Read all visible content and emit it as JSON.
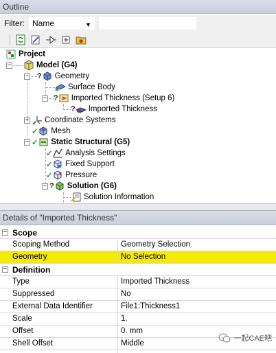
{
  "outline": {
    "title": "Outline",
    "filter_label": "Filter:",
    "filter_value": "Name",
    "filter_search": ""
  },
  "tree": [
    {
      "label": "Project",
      "bold": true,
      "icon": "project-icon"
    },
    {
      "label": "Model (G4)",
      "bold": true,
      "icon": "model-icon"
    },
    {
      "label": "Geometry",
      "bold": false,
      "icon": "geometry-icon"
    },
    {
      "label": "Surface Body",
      "bold": false,
      "icon": "surface-body-icon"
    },
    {
      "label": "Imported Thickness (Setup 6)",
      "bold": false,
      "icon": "imported-thickness-folder-icon"
    },
    {
      "label": "Imported Thickness",
      "bold": false,
      "icon": "imported-thickness-icon"
    },
    {
      "label": "Coordinate Systems",
      "bold": false,
      "icon": "coordinate-systems-icon"
    },
    {
      "label": "Mesh",
      "bold": false,
      "icon": "mesh-icon"
    },
    {
      "label": "Static Structural (G5)",
      "bold": true,
      "icon": "static-structural-icon"
    },
    {
      "label": "Analysis Settings",
      "bold": false,
      "icon": "analysis-settings-icon"
    },
    {
      "label": "Fixed Support",
      "bold": false,
      "icon": "fixed-support-icon"
    },
    {
      "label": "Pressure",
      "bold": false,
      "icon": "pressure-icon"
    },
    {
      "label": "Solution (G6)",
      "bold": true,
      "icon": "solution-icon"
    },
    {
      "label": "Solution Information",
      "bold": false,
      "icon": "solution-information-icon"
    }
  ],
  "details": {
    "title": "Details of \"Imported Thickness\"",
    "sections": [
      {
        "name": "Scope",
        "rows": [
          {
            "key": "Scoping Method",
            "value": "Geometry Selection"
          },
          {
            "key": "Geometry",
            "value": "No Selection",
            "highlight": true
          }
        ]
      },
      {
        "name": "Definition",
        "rows": [
          {
            "key": "Type",
            "value": "Imported Thickness"
          },
          {
            "key": "Suppressed",
            "value": "No"
          },
          {
            "key": "External Data Identifier",
            "value": "File1:Thickness1"
          },
          {
            "key": "Scale",
            "value": "1."
          },
          {
            "key": "Offset",
            "value": "0. mm"
          },
          {
            "key": "Shell Offset",
            "value": "Middle"
          }
        ]
      }
    ]
  },
  "watermark": "一起CAE吧",
  "colors": {
    "highlight": "#f6ea00",
    "header_bg": "#cfd6e1",
    "check_green": "#2e8b2e"
  }
}
